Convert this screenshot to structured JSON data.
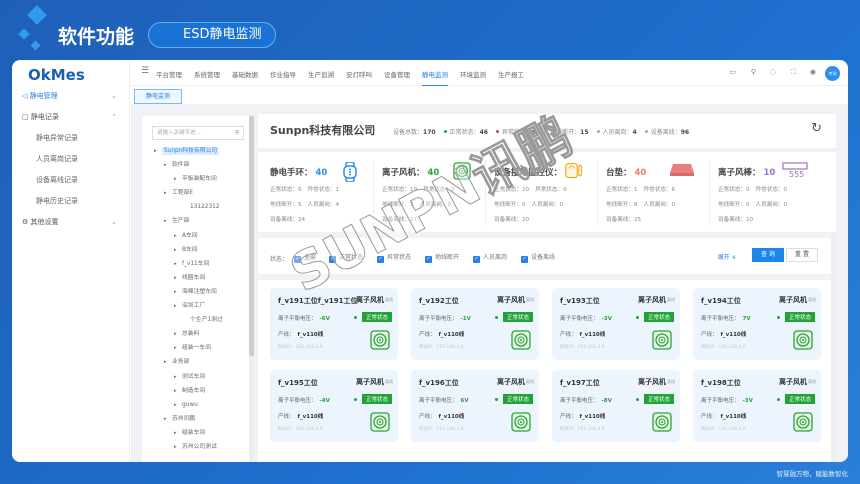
{
  "header": {
    "title": "软件功能",
    "pill": "ESD静电监测"
  },
  "brand": "OkMes",
  "sidebar": {
    "items": [
      {
        "label": "静电管理",
        "chev": "⌄",
        "active": true,
        "sub": false
      },
      {
        "label": "静电记录",
        "chev": "⌃",
        "active": false,
        "sub": false
      },
      {
        "label": "静电异常记录",
        "sub": true
      },
      {
        "label": "人员离岗记录",
        "sub": true
      },
      {
        "label": "设备离线记录",
        "sub": true
      },
      {
        "label": "静电历史记录",
        "sub": true
      },
      {
        "label": "其他设置",
        "chev": "⌄",
        "active": false,
        "sub": false
      }
    ]
  },
  "topnav": {
    "items": [
      "平台管理",
      "系统管理",
      "基础数据",
      "作业指导",
      "生产追溯",
      "安灯呼叫",
      "设备管理",
      "静电监测",
      "环境监测",
      "生产报工"
    ],
    "active": "静电监测",
    "avatar": "考测"
  },
  "tab": "静电监测",
  "tree": {
    "search_placeholder": "请输入关键字进...",
    "nodes": [
      {
        "label": "Sunpn科技有限公司",
        "level": 0,
        "sel": true
      },
      {
        "label": "软件部",
        "level": 1
      },
      {
        "label": "平板装配车间",
        "level": 2
      },
      {
        "label": "工程部E",
        "level": 1
      },
      {
        "label": "13122312",
        "level": 2,
        "leaf": true
      },
      {
        "label": "生产部",
        "level": 1
      },
      {
        "label": "A车间",
        "level": 2
      },
      {
        "label": "B车间",
        "level": 2
      },
      {
        "label": "f_v11车间",
        "level": 2
      },
      {
        "label": "线圈车间",
        "level": 2
      },
      {
        "label": "海棉注塑车间",
        "level": 2
      },
      {
        "label": "深圳工厂",
        "level": 2
      },
      {
        "label": "个生产1测过",
        "level": 2,
        "leaf": true
      },
      {
        "label": "总装料",
        "level": 2
      },
      {
        "label": "组装一车间",
        "level": 2
      },
      {
        "label": "业务部",
        "level": 1
      },
      {
        "label": "测试车间",
        "level": 2
      },
      {
        "label": "制造车间",
        "level": 2
      },
      {
        "label": "guwu",
        "level": 2
      },
      {
        "label": "苏州讯鹏",
        "level": 1
      },
      {
        "label": "组装车间",
        "level": 2
      },
      {
        "label": "苏州公司测试",
        "level": 2
      }
    ]
  },
  "company": {
    "name": "Sunpn科技有限公司",
    "total_label": "设备总数：",
    "total": "170",
    "stats": [
      {
        "label": "正常状态：",
        "value": "46",
        "color": "#2aa23c"
      },
      {
        "label": "异常状态：",
        "value": "9",
        "color": "#e0393e"
      },
      {
        "label": "地线断开：",
        "value": "15",
        "color": "#f0b400"
      },
      {
        "label": "人员离岗：",
        "value": "4",
        "color": "#7fb6e8"
      },
      {
        "label": "设备离线：",
        "value": "96",
        "color": "#aaaaaa"
      }
    ]
  },
  "devices": [
    {
      "name": "静电手环：",
      "count": "40",
      "color": "#2b8ef0",
      "icon": "watch-icon",
      "normal": "6",
      "abnormal": "1",
      "ground": "5",
      "away": "4",
      "offline": "24"
    },
    {
      "name": "离子风机：",
      "count": "40",
      "color": "#2aa23c",
      "icon": "fan-icon",
      "normal": "19",
      "abnormal": "2",
      "ground": "2",
      "away": "0",
      "offline": "17"
    },
    {
      "name": "设备接地监控仪：",
      "count": "40",
      "color": "#f08a00",
      "icon": "ground-monitor-icon",
      "normal": "20",
      "abnormal": "0",
      "ground": "0",
      "away": "0",
      "offline": "20"
    },
    {
      "name": "台垫：",
      "count": "40",
      "color": "#ef7a7a",
      "icon": "mat-icon",
      "normal": "1",
      "abnormal": "6",
      "ground": "8",
      "away": "0",
      "offline": "25"
    },
    {
      "name": "离子风棒：",
      "count": "10",
      "color": "#a070c8",
      "icon": "ion-bar-icon",
      "normal": "0",
      "abnormal": "0",
      "ground": "0",
      "away": "0",
      "offline": "10"
    }
  ],
  "dev_labels": {
    "normal": "正常状态：",
    "abnormal": "异常状态：",
    "ground": "地线断开：",
    "away": "人员离岗：",
    "offline": "设备离线："
  },
  "filter": {
    "label": "状态：",
    "options": [
      "全部",
      "正常状态",
      "异常状态",
      "地线断开",
      "人员离岗",
      "设备离线"
    ],
    "expand": "展开 ∨",
    "query": "查 询",
    "reset": "重 置"
  },
  "cards": [
    {
      "station": "f_v191工位f_v191工位",
      "type": "离子风机",
      "voltage": "-6V"
    },
    {
      "station": "f_v192工位",
      "type": "离子风机",
      "voltage": "-1V"
    },
    {
      "station": "f_v193工位",
      "type": "离子风机",
      "voltage": "-3V"
    },
    {
      "station": "f_v194工位",
      "type": "离子风机",
      "voltage": "7V"
    },
    {
      "station": "f_v195工位",
      "type": "离子风机",
      "voltage": "-4V"
    },
    {
      "station": "f_v196工位",
      "type": "离子风机",
      "voltage": "6V"
    },
    {
      "station": "f_v197工位",
      "type": "离子风机",
      "voltage": "-8V"
    },
    {
      "station": "f_v198工位",
      "type": "离子风机",
      "voltage": "-3V"
    }
  ],
  "card_labels": {
    "tag": "离线",
    "voltage": "离子平衡电压：",
    "status": "正常状态",
    "line_label": "产线：",
    "line": "f_v110线",
    "ip": "网关IP：192.168.3.6"
  },
  "watermark": "SUNPN讯鹏",
  "slogan": "智慧融万物，赋能数智化"
}
